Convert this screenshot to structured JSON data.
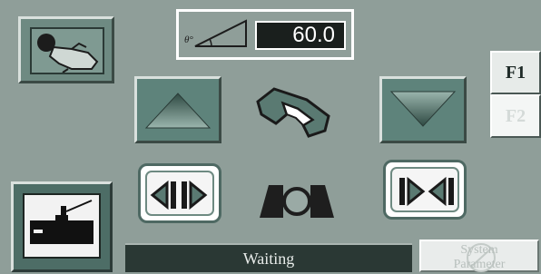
{
  "angle": {
    "label": "θ°",
    "value": "60.0"
  },
  "fkeys": {
    "f1": "F1",
    "f2": "F2"
  },
  "status": {
    "text": "Waiting"
  },
  "system_button": {
    "line1": "System",
    "line2": "Parameter"
  },
  "icons": {
    "touch": "hand-touch-icon",
    "up": "up-arrow-icon",
    "down": "down-arrow-icon",
    "hand": "gripper-hand-icon",
    "open": "open-jaw-icon",
    "close": "close-jaw-icon",
    "clamp": "clamp-icon",
    "welder": "welding-torch-icon"
  },
  "colors": {
    "panel": "#8f9e99",
    "status_bg": "#2a3834",
    "value_bg": "#1a1f1d"
  }
}
